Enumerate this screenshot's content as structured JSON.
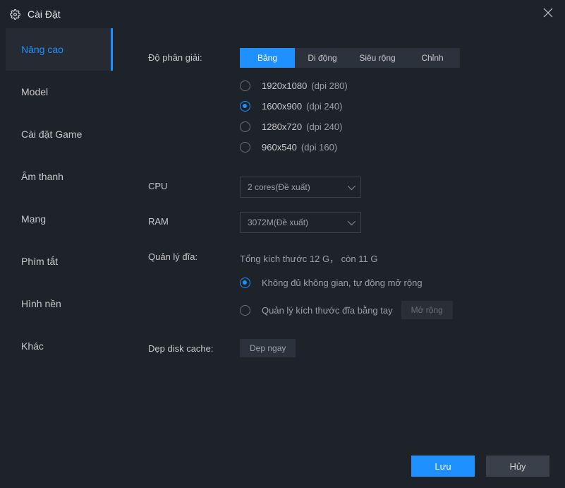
{
  "window": {
    "title": "Cài Đặt"
  },
  "sidebar": {
    "items": [
      {
        "label": "Nâng cao"
      },
      {
        "label": "Model"
      },
      {
        "label": "Cài đặt Game"
      },
      {
        "label": "Âm thanh"
      },
      {
        "label": "Mạng"
      },
      {
        "label": "Phím tắt"
      },
      {
        "label": "Hình nền"
      },
      {
        "label": "Khác"
      }
    ],
    "active_index": 0
  },
  "main": {
    "resolution": {
      "label": "Độ phân giải:",
      "tabs": [
        {
          "label": "Bảng"
        },
        {
          "label": "Di động"
        },
        {
          "label": "Siêu rộng"
        },
        {
          "label": "Chỉnh"
        }
      ],
      "active_tab": 0,
      "options": [
        {
          "res": "1920x1080",
          "dpi": "(dpi 280)"
        },
        {
          "res": "1600x900",
          "dpi": "(dpi 240)"
        },
        {
          "res": "1280x720",
          "dpi": "(dpi 240)"
        },
        {
          "res": "960x540",
          "dpi": "(dpi 160)"
        }
      ],
      "selected_index": 1
    },
    "cpu": {
      "label": "CPU",
      "value": "2 cores(Đề xuất)"
    },
    "ram": {
      "label": "RAM",
      "value": "3072M(Đề xuất)"
    },
    "disk": {
      "label": "Quản lý đĩa:",
      "info": "Tổng kích thước 12 G， còn  11 G",
      "options": [
        {
          "label": "Không đủ không gian, tự động mở rộng"
        },
        {
          "label": "Quản lý kích thước đĩa bằng tay"
        }
      ],
      "selected_index": 0,
      "expand_btn": "Mở rộng"
    },
    "cache": {
      "label": "Dẹp disk cache:",
      "btn": "Dẹp ngay"
    }
  },
  "footer": {
    "save": "Lưu",
    "cancel": "Hủy"
  }
}
